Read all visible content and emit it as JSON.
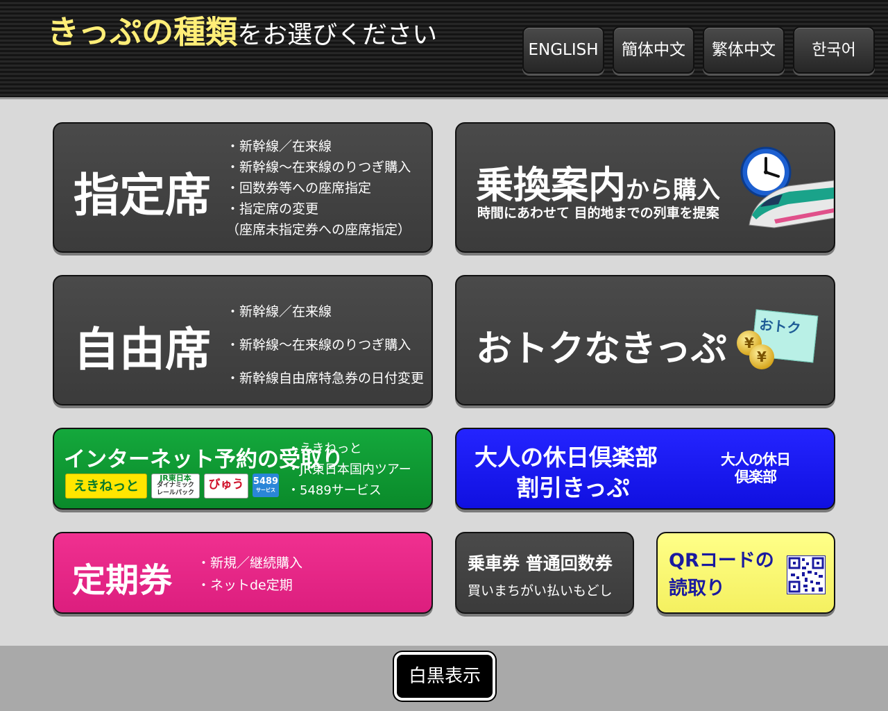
{
  "header": {
    "title_strong": "きっぷの種類",
    "title_rest": "をお選びください",
    "languages": [
      "ENGLISH",
      "簡体中文",
      "繁体中文",
      "한국어"
    ]
  },
  "reserved": {
    "label": "指定席",
    "bullets": [
      "・新幹線／在来線",
      "・新幹線～在来線のりつぎ購入",
      "・回数券等への座席指定",
      "・指定席の変更",
      "（座席未指定券への座席指定）"
    ]
  },
  "transfer": {
    "label": "乗換案内",
    "label_suffix": "から購入",
    "sub": "時間にあわせて 目的地までの列車を提案"
  },
  "unreserved": {
    "label": "自由席",
    "bullets": [
      "・新幹線／在来線",
      "・新幹線～在来線のりつぎ購入",
      "・新幹線自由席特急券の日付変更"
    ]
  },
  "discount": {
    "label": "おトクなきっぷ",
    "tag": "おトク",
    "coin": "¥"
  },
  "internet": {
    "label": "インターネット予約の受取り",
    "bullets": [
      "・えきねっと",
      "・JR東日本国内ツアー",
      "・5489サービス"
    ],
    "logos": {
      "ekinet": "えきねっと",
      "jr_line1": "JR東日本",
      "jr_line2": "ダイナミック",
      "jr_line3": "レールパック",
      "viewru": "びゅう",
      "n5489": "5489",
      "n5489_sub": "サービス"
    }
  },
  "otona": {
    "line1": "大人の休日倶楽部",
    "line2": "割引きっぷ",
    "logo_line1": "大人の休日",
    "logo_line2": "倶楽部"
  },
  "commuter": {
    "label": "定期券",
    "bullets": [
      "・新規／継続購入",
      "・ネットde定期"
    ]
  },
  "refund": {
    "line1": "乗車券 普通回数券",
    "line2": "買いまちがい払いもどし"
  },
  "qr": {
    "line1": "QRコードの",
    "line2": "読取り"
  },
  "footer": {
    "mono_label": "白黒表示"
  },
  "colors": {
    "title_yellow": "#ffee77",
    "internet_green": "#14a83c",
    "otona_blue": "#2424ff",
    "commuter_pink": "#f03090",
    "qr_yellow": "#ffff88",
    "qr_text": "#1a1aa0"
  }
}
